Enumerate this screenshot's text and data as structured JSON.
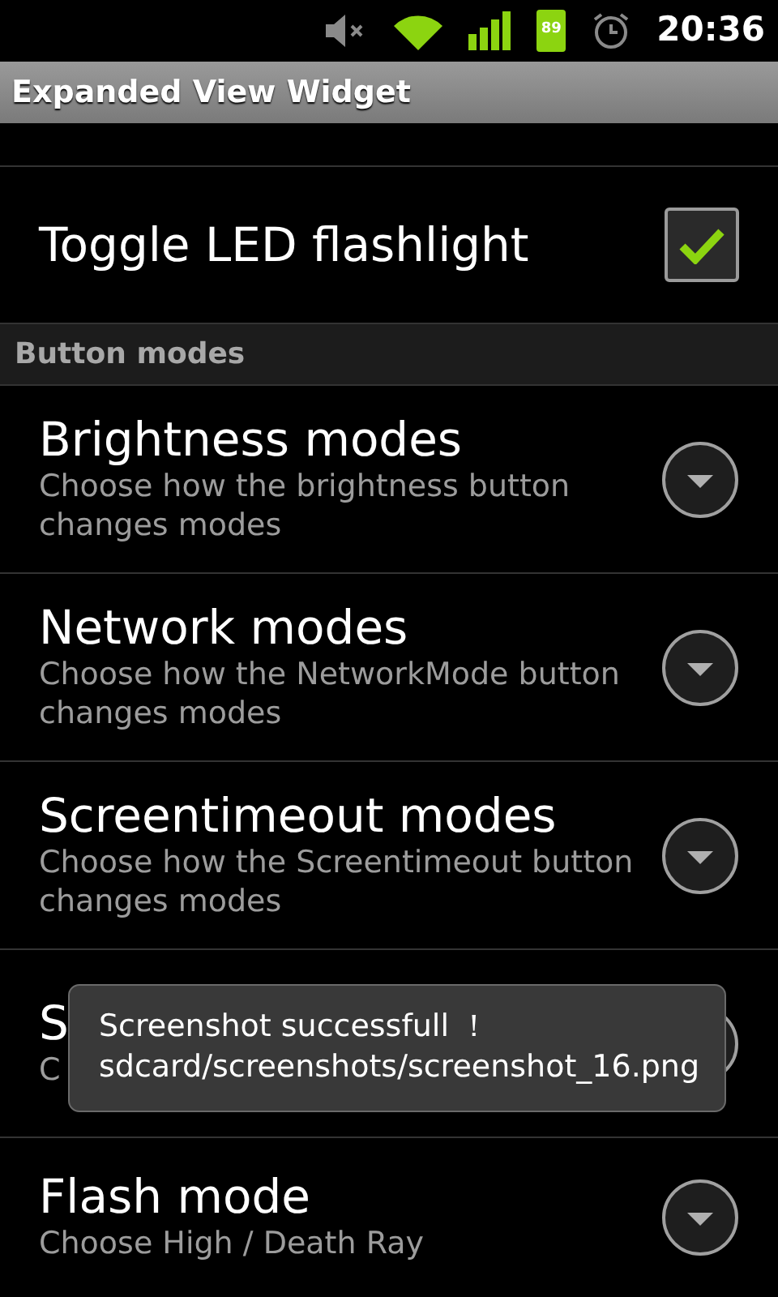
{
  "status_bar": {
    "battery": "89",
    "time": "20:36"
  },
  "window": {
    "title": "Expanded View Widget"
  },
  "items": [
    {
      "kind": "checkbox",
      "title": "Toggle LED flashlight",
      "checked": true
    },
    {
      "kind": "category",
      "title": "Button modes"
    },
    {
      "kind": "list",
      "title": "Brightness modes",
      "summary": "Choose how the brightness button changes modes"
    },
    {
      "kind": "list",
      "title": "Network modes",
      "summary": "Choose how the NetworkMode button changes modes"
    },
    {
      "kind": "list",
      "title": "Screentimeout modes",
      "summary": "Choose how the Screentimeout button changes modes"
    },
    {
      "kind": "list",
      "title": "S",
      "summary": "C"
    },
    {
      "kind": "list",
      "title": "Flash mode",
      "summary": "Choose High / Death Ray"
    }
  ],
  "toast": {
    "lines": [
      "Screenshot successfull ！",
      "sdcard/screenshots/screenshot_16.png"
    ]
  }
}
